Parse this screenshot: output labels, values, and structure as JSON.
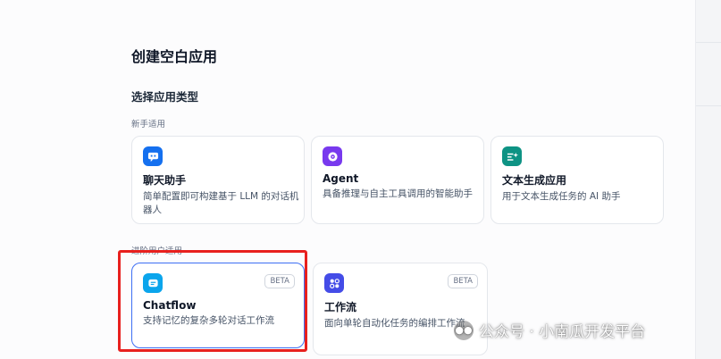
{
  "page_title": "创建空白应用",
  "section_title": "选择应用类型",
  "groups": [
    {
      "label": "新手适用",
      "cards": [
        {
          "icon": "chat-assistant-icon",
          "icon_color": "#1570ef",
          "name": "聊天助手",
          "desc": "简单配置即可构建基于 LLM 的对话机器人"
        },
        {
          "icon": "agent-icon",
          "icon_color": "#7839ee",
          "name": "Agent",
          "desc": "具备推理与自主工具调用的智能助手"
        },
        {
          "icon": "text-generation-icon",
          "icon_color": "#0e9384",
          "name": "文本生成应用",
          "desc": "用于文本生成任务的 AI 助手"
        }
      ]
    },
    {
      "label": "进阶用户适用",
      "cards": [
        {
          "icon": "chatflow-icon",
          "icon_color": "#0ba5ec",
          "name": "Chatflow",
          "desc": "支持记忆的复杂多轮对话工作流",
          "badge": "BETA"
        },
        {
          "icon": "workflow-icon",
          "icon_color": "#444ce7",
          "name": "工作流",
          "desc": "面向单轮自动化任务的编排工作流",
          "badge": "BETA"
        }
      ]
    }
  ],
  "watermark": "公众号 · 小南瓜开发平台"
}
